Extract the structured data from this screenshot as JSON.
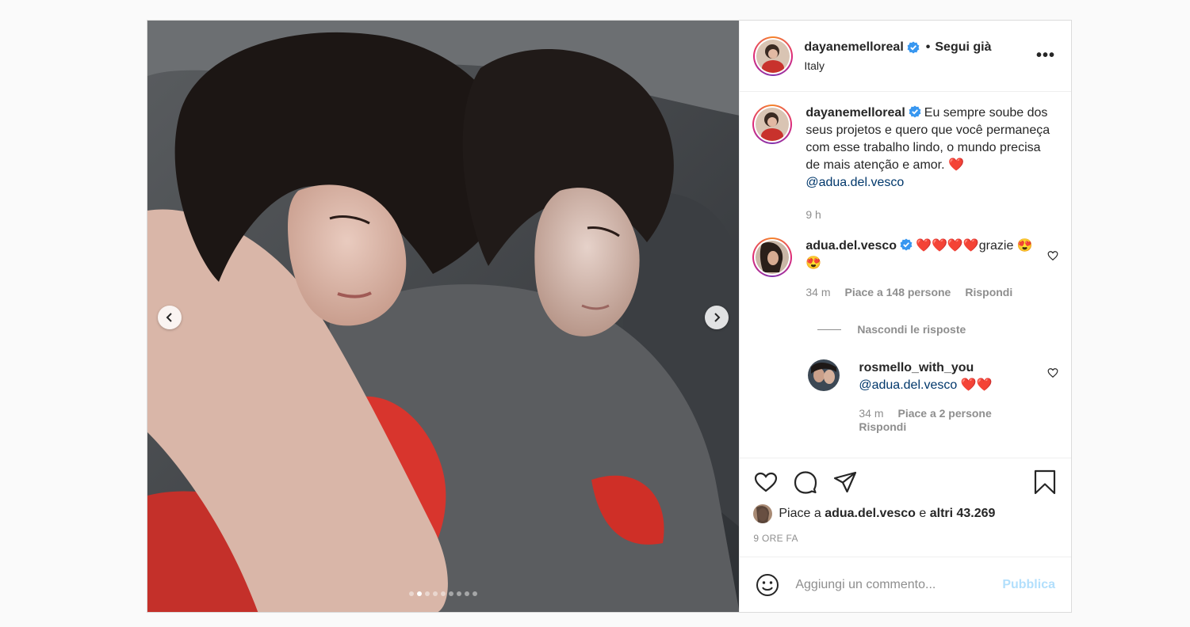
{
  "post": {
    "author": "dayanemelloreal",
    "follow_status": "Segui già",
    "location": "Italy",
    "more_icon": "more-options-icon",
    "carousel": {
      "total_slides": 9,
      "active_slide": 2
    }
  },
  "caption": {
    "username": "dayanemelloreal",
    "text": "Eu sempre soube dos seus projetos e quero que você permaneça com esse trabalho lindo, o mundo precisa de mais atenção e amor. ❤️",
    "mention": "@adua.del.vesco",
    "time": "9 h"
  },
  "comments": [
    {
      "username": "adua.del.vesco",
      "text": "❤️❤️❤️❤️grazie 😍😍",
      "time": "34 m",
      "likes": "Piace a 148 persone",
      "reply_label": "Rispondi",
      "hide_replies": "Nascondi le risposte",
      "replies": [
        {
          "username": "rosmello_with_you",
          "mention": "@adua.del.vesco",
          "text": " ❤️❤️",
          "time": "34 m",
          "likes": "Piace a 2 persone",
          "reply_label": "Rispondi"
        }
      ]
    }
  ],
  "likes_line": {
    "prefix": "Piace a",
    "user": "adua.del.vesco",
    "joiner": "e",
    "others": "altri 43.269"
  },
  "timestamp": "9 ORE FA",
  "add_comment": {
    "placeholder": "Aggiungi un commento...",
    "publish_label": "Pubblica"
  },
  "colors": {
    "link": "#00376b",
    "verified": "#3897f0",
    "muted": "#8e8e8e",
    "publish_disabled": "#b2dffc"
  }
}
